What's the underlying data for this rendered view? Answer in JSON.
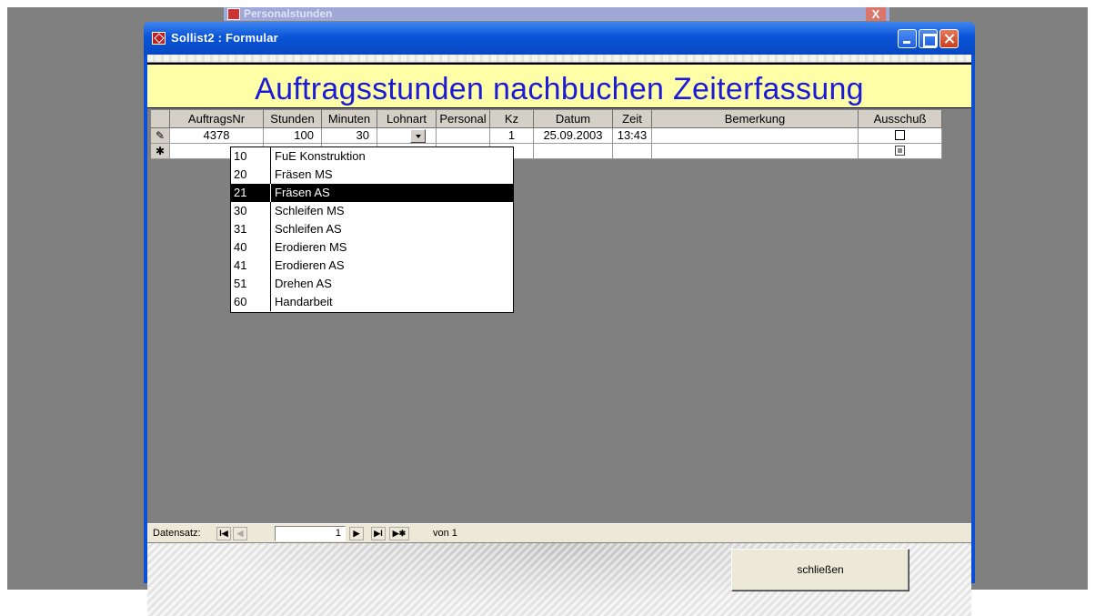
{
  "background_window": {
    "title": "Personalstunden",
    "close_label": "X"
  },
  "window": {
    "title": "Sollist2 : Formular"
  },
  "form": {
    "heading": "Auftragsstunden nachbuchen Zeiterfassung"
  },
  "table": {
    "columns": [
      "AuftragsNr",
      "Stunden",
      "Minuten",
      "Lohnart",
      "Personal",
      "Kz",
      "Datum",
      "Zeit",
      "Bemerkung",
      "Ausschuß"
    ],
    "rows": [
      {
        "selector": "✎",
        "AuftragsNr": "4378",
        "Stunden": "100",
        "Minuten": "30",
        "Lohnart": "",
        "Personal": "",
        "Kz": "1",
        "Datum": "25.09.2003",
        "Zeit": "13:43",
        "Bemerkung": "",
        "Ausschuss": false
      },
      {
        "selector": "✱",
        "AuftragsNr": "",
        "Stunden": "",
        "Minuten": "",
        "Lohnart": "",
        "Personal": "",
        "Kz": "",
        "Datum": "",
        "Zeit": "",
        "Bemerkung": "",
        "Ausschuss": "indeterminate"
      }
    ]
  },
  "dropdown": {
    "selected_code": "21",
    "items": [
      {
        "code": "10",
        "label": "FuE Konstruktion"
      },
      {
        "code": "20",
        "label": "Fräsen MS"
      },
      {
        "code": "21",
        "label": "Fräsen AS"
      },
      {
        "code": "30",
        "label": "Schleifen MS"
      },
      {
        "code": "31",
        "label": "Schleifen AS"
      },
      {
        "code": "40",
        "label": "Erodieren MS"
      },
      {
        "code": "41",
        "label": "Erodieren AS"
      },
      {
        "code": "51",
        "label": "Drehen AS"
      },
      {
        "code": "60",
        "label": "Handarbeit"
      }
    ]
  },
  "navigation": {
    "label": "Datensatz:",
    "current": "1",
    "of_text": "von 1",
    "buttons": {
      "first": "I◀",
      "prev": "◀",
      "next": "▶",
      "last": "▶I",
      "new": "▶✱"
    }
  },
  "footer": {
    "close_label": "schließen"
  },
  "colors": {
    "heading_text": "#1a1ad8",
    "heading_bg": "#ffffa8",
    "titlebar": "#0a54d8"
  }
}
